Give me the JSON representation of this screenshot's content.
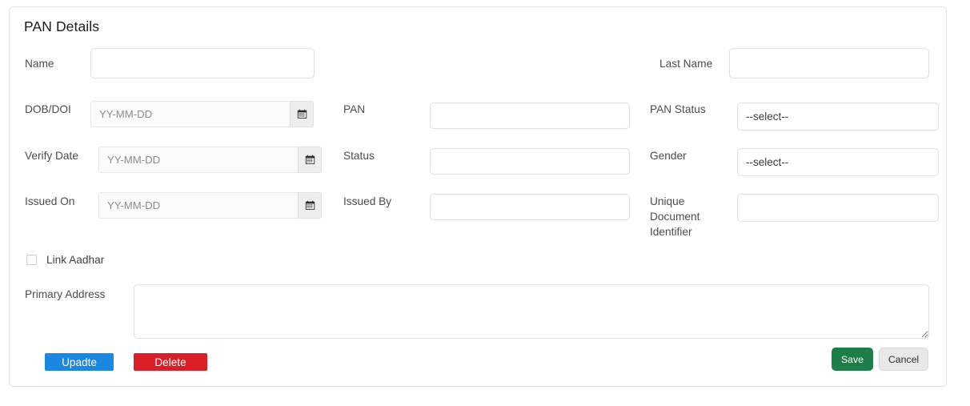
{
  "card": {
    "title": "PAN Details"
  },
  "fields": {
    "name": {
      "label": "Name",
      "value": "",
      "placeholder": ""
    },
    "last_name": {
      "label": "Last Name",
      "value": "",
      "placeholder": ""
    },
    "dob_doi": {
      "label": "DOB/DOI",
      "value": "",
      "placeholder": "YY-MM-DD",
      "icon": "calendar-icon"
    },
    "pan": {
      "label": "PAN",
      "value": "",
      "placeholder": ""
    },
    "pan_status": {
      "label": "PAN Status",
      "value": "--select--",
      "options": [
        "--select--"
      ]
    },
    "verify_date": {
      "label": "Verify Date",
      "value": "",
      "placeholder": "YY-MM-DD",
      "icon": "calendar-icon"
    },
    "status": {
      "label": "Status",
      "value": "",
      "placeholder": ""
    },
    "gender": {
      "label": "Gender",
      "value": "--select--",
      "options": [
        "--select--"
      ]
    },
    "issued_on": {
      "label": "Issued On",
      "value": "",
      "placeholder": "YY-MM-DD",
      "icon": "calendar-icon"
    },
    "issued_by": {
      "label": "Issued By",
      "value": "",
      "placeholder": ""
    },
    "unique_document_identifier": {
      "label": "Unique Document Identifier",
      "value": "",
      "placeholder": ""
    },
    "link_aadhar": {
      "label": "Link Aadhar",
      "checked": false
    },
    "primary_address": {
      "label": "Primary Address",
      "value": "",
      "placeholder": ""
    }
  },
  "buttons": {
    "update": {
      "label": "Upadte",
      "color": "#1a87e0"
    },
    "delete": {
      "label": "Delete",
      "color": "#d81f28"
    },
    "save": {
      "label": "Save",
      "color": "#1e7e48"
    },
    "cancel": {
      "label": "Cancel",
      "color": "#e8e8e8"
    }
  }
}
